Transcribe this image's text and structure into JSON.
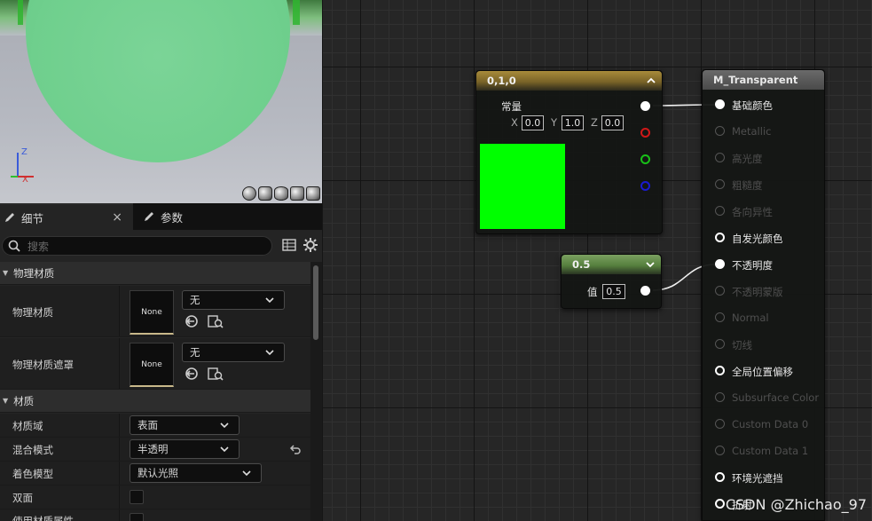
{
  "viewport": {
    "axis_z": "Z",
    "axis_x": "X",
    "preview_shapes": [
      "sphere-icon",
      "cylinder-icon",
      "plane-icon",
      "cube-icon",
      "teapot-icon"
    ]
  },
  "tabs": {
    "details_label": "细节",
    "params_label": "参数",
    "close_glyph": "×"
  },
  "search": {
    "placeholder": "搜索"
  },
  "details": {
    "category_physical": "物理材质",
    "physical_material": {
      "label": "物理材质",
      "thumb": "None",
      "value": "无"
    },
    "physical_material_mask": {
      "label": "物理材质遮罩",
      "thumb": "None",
      "value": "无"
    },
    "category_material": "材质",
    "material_domain": {
      "label": "材质域",
      "value": "表面"
    },
    "blend_mode": {
      "label": "混合模式",
      "value": "半透明"
    },
    "shading_model": {
      "label": "着色模型",
      "value": "默认光照"
    },
    "two_sided": {
      "label": "双面"
    },
    "use_material_attributes": {
      "label": "使用材质属性"
    }
  },
  "graph": {
    "constant3_node": {
      "title": "0,1,0",
      "output_label": "常量",
      "x_label": "X",
      "x_value": "0.0",
      "y_label": "Y",
      "y_value": "1.0",
      "z_label": "Z",
      "z_value": "0.0",
      "swatch_color": "#00ff00"
    },
    "scalar_node": {
      "title": "0.5",
      "value_label": "值",
      "value": "0.5"
    },
    "result_node": {
      "title": "M_Transparent",
      "pins": [
        {
          "label": "基础颜色",
          "state": "connected"
        },
        {
          "label": "Metallic",
          "state": "disabled"
        },
        {
          "label": "高光度",
          "state": "disabled"
        },
        {
          "label": "粗糙度",
          "state": "disabled"
        },
        {
          "label": "各向异性",
          "state": "disabled"
        },
        {
          "label": "自发光颜色",
          "state": "enabled"
        },
        {
          "label": "不透明度",
          "state": "connected"
        },
        {
          "label": "不透明蒙版",
          "state": "disabled"
        },
        {
          "label": "Normal",
          "state": "disabled"
        },
        {
          "label": "切线",
          "state": "disabled"
        },
        {
          "label": "全局位置偏移",
          "state": "enabled"
        },
        {
          "label": "Subsurface Color",
          "state": "disabled"
        },
        {
          "label": "Custom Data 0",
          "state": "disabled"
        },
        {
          "label": "Custom Data 1",
          "state": "disabled"
        },
        {
          "label": "环境光遮挡",
          "state": "enabled"
        },
        {
          "label": "折射",
          "state": "enabled"
        }
      ]
    }
  },
  "watermark": "CSDN @Zhichao_97"
}
